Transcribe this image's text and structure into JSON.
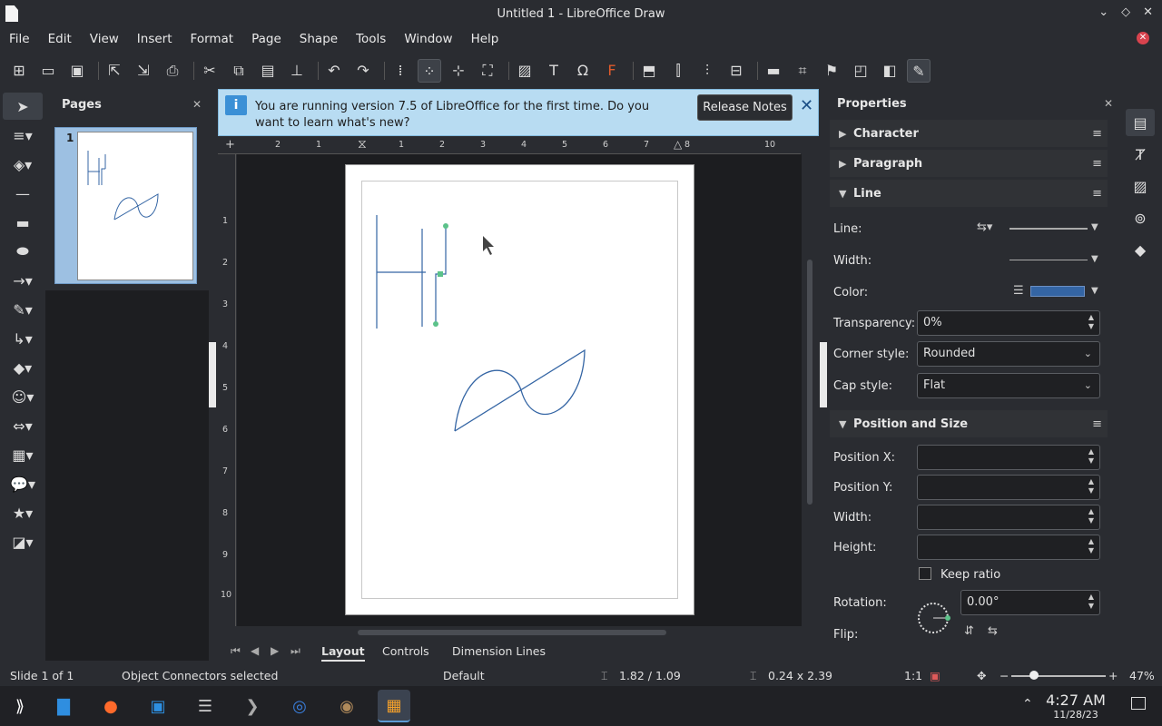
{
  "window": {
    "title": "Untitled 1 - LibreOffice Draw"
  },
  "menubar": {
    "items": [
      "File",
      "Edit",
      "View",
      "Insert",
      "Format",
      "Page",
      "Shape",
      "Tools",
      "Window",
      "Help"
    ]
  },
  "pages_panel": {
    "title": "Pages",
    "page_number": "1"
  },
  "infobar": {
    "message": "You are running version 7.5 of LibreOffice for the first time. Do you want to learn what's new?",
    "button": "Release Notes"
  },
  "ruler_h": [
    "2",
    "1",
    "1",
    "2",
    "3",
    "4",
    "5",
    "6",
    "7",
    "8",
    "10"
  ],
  "ruler_v": [
    "1",
    "2",
    "3",
    "4",
    "5",
    "6",
    "7",
    "8",
    "9",
    "10"
  ],
  "tabs": {
    "items": [
      "Layout",
      "Controls",
      "Dimension Lines"
    ],
    "active": "Layout"
  },
  "properties": {
    "title": "Properties",
    "sections": {
      "character": "Character",
      "paragraph": "Paragraph",
      "line": "Line",
      "position_size": "Position and Size"
    },
    "line": {
      "line_label": "Line:",
      "width_label": "Width:",
      "color_label": "Color:",
      "color_value": "#3465a4",
      "transparency_label": "Transparency:",
      "transparency_value": "0%",
      "corner_label": "Corner style:",
      "corner_value": "Rounded",
      "cap_label": "Cap style:",
      "cap_value": "Flat"
    },
    "position": {
      "pos_x_label": "Position X:",
      "pos_y_label": "Position Y:",
      "width_label": "Width:",
      "height_label": "Height:",
      "keep_ratio": "Keep ratio",
      "rotation_label": "Rotation:",
      "rotation_value": "0.00°",
      "flip_label": "Flip:"
    }
  },
  "statusbar": {
    "slide": "Slide 1 of 1",
    "selection": "Object Connectors selected",
    "layout": "Default",
    "position": "1.82 / 1.09",
    "size": "0.24 x 2.39",
    "scale": "1:1",
    "zoom": "47%"
  },
  "taskbar": {
    "time": "4:27 AM",
    "date": "11/28/23"
  }
}
